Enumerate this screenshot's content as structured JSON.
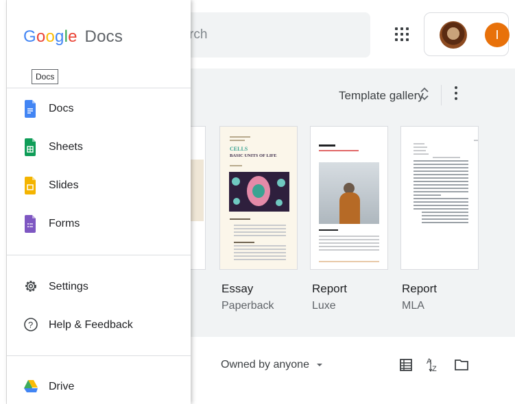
{
  "header": {
    "search_placeholder_visible": "rch",
    "avatar_letter": "I"
  },
  "templates": {
    "gallery_label": "Template gallery",
    "gallery_toggle_icon": "unfold-more-icon",
    "more_icon": "vertical-dots-icon",
    "items": [
      {
        "name": "Essay",
        "sub": "Paperback",
        "thumb_title": "CELLS",
        "thumb_heading": "BASIC UNITS OF LIFE"
      },
      {
        "name": "Report",
        "sub": "Luxe"
      },
      {
        "name": "Report",
        "sub": "MLA"
      }
    ]
  },
  "documents": {
    "owner_filter": "Owned by anyone"
  },
  "drawer": {
    "logo_google": [
      "G",
      "o",
      "o",
      "g",
      "l",
      "e"
    ],
    "logo_product": "Docs",
    "tooltip": "Docs",
    "apps": [
      {
        "label": "Docs",
        "icon": "docs-icon",
        "color": "#4285f4"
      },
      {
        "label": "Sheets",
        "icon": "sheets-icon",
        "color": "#0f9d58"
      },
      {
        "label": "Slides",
        "icon": "slides-icon",
        "color": "#f4b400"
      },
      {
        "label": "Forms",
        "icon": "forms-icon",
        "color": "#7e57c2"
      }
    ],
    "settings_label": "Settings",
    "help_label": "Help & Feedback",
    "drive_label": "Drive"
  },
  "colors": {
    "google_blue": "#4285f4",
    "google_red": "#ea4335",
    "google_yellow": "#fbbc05",
    "google_green": "#34a853",
    "avatar_orange": "#e8710a"
  }
}
